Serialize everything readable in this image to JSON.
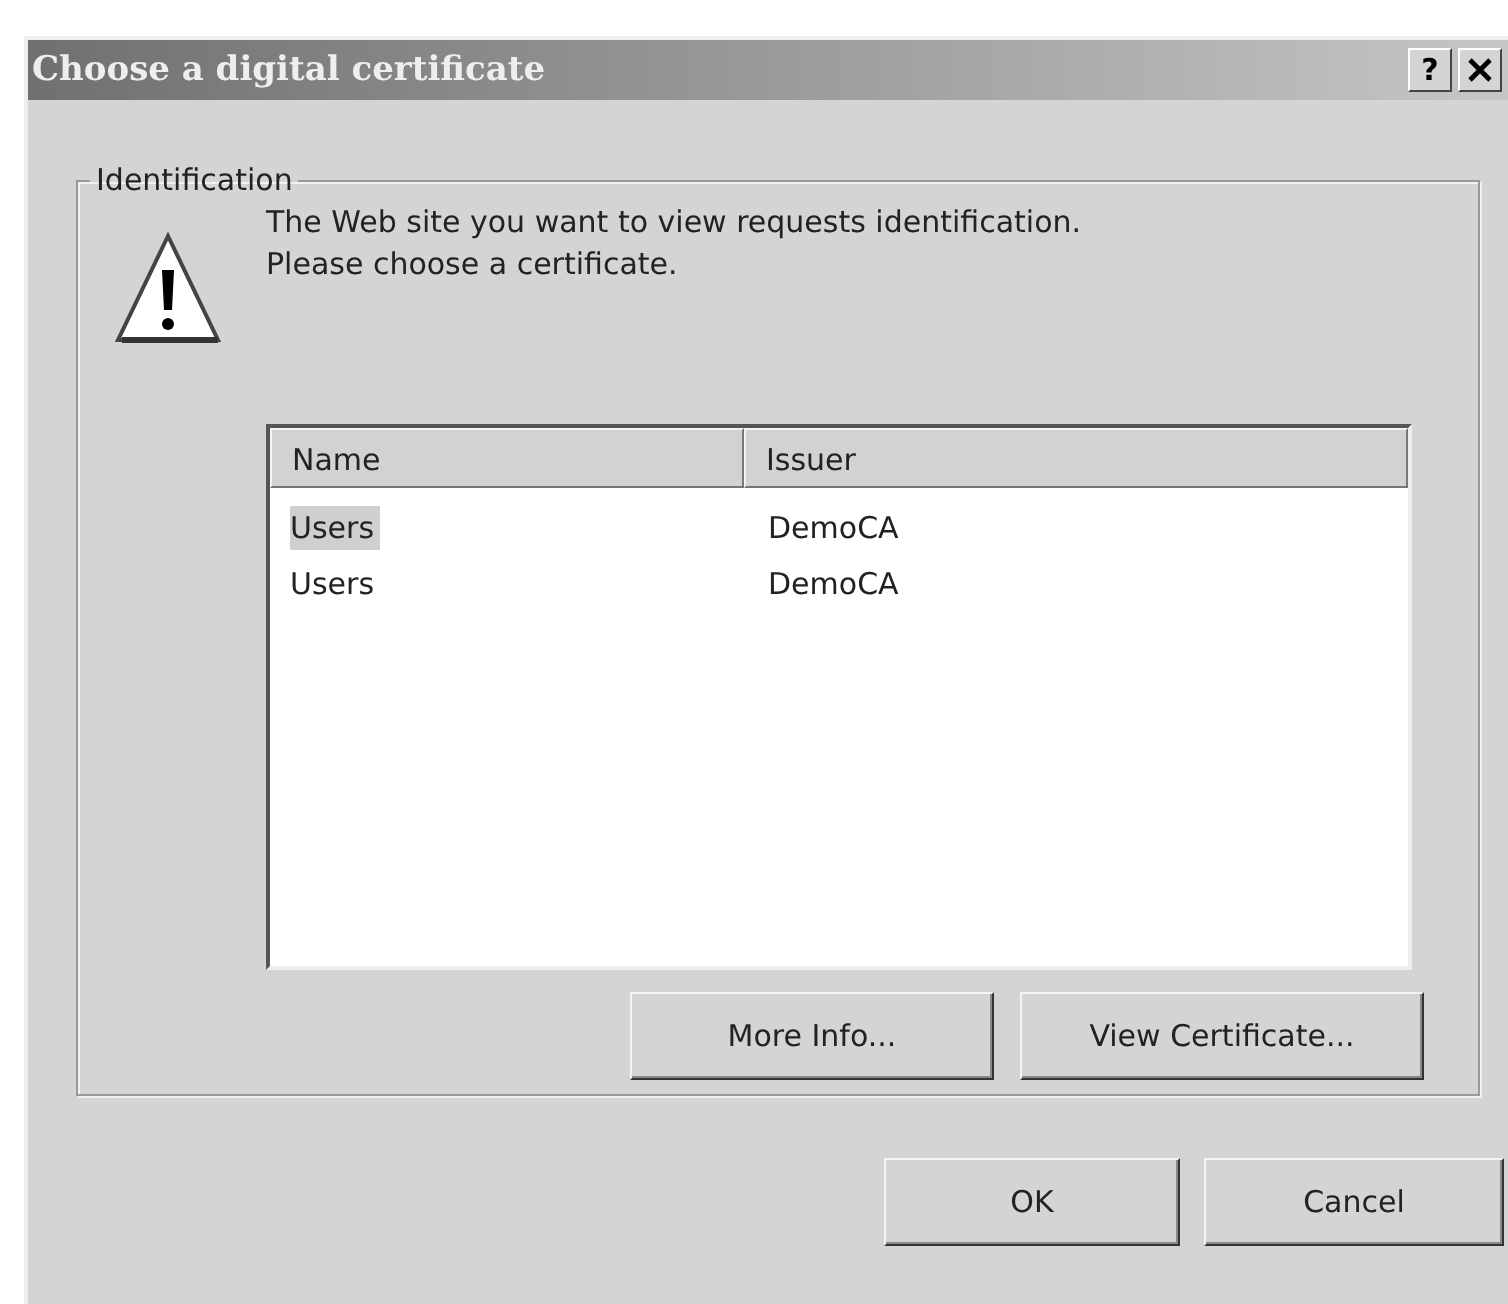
{
  "window": {
    "title": "Choose a digital certificate",
    "help_button": "?"
  },
  "group": {
    "legend": "Identification",
    "message": "The Web site you want to view requests identification. Please choose a certificate."
  },
  "table": {
    "columns": [
      "Name",
      "Issuer"
    ],
    "rows": [
      {
        "name": "Users",
        "issuer": "DemoCA",
        "selected": true
      },
      {
        "name": "Users",
        "issuer": "DemoCA",
        "selected": false
      }
    ]
  },
  "list_buttons": [
    "More Info...",
    "View Certificate..."
  ],
  "buttons": [
    "OK",
    "Cancel"
  ]
}
